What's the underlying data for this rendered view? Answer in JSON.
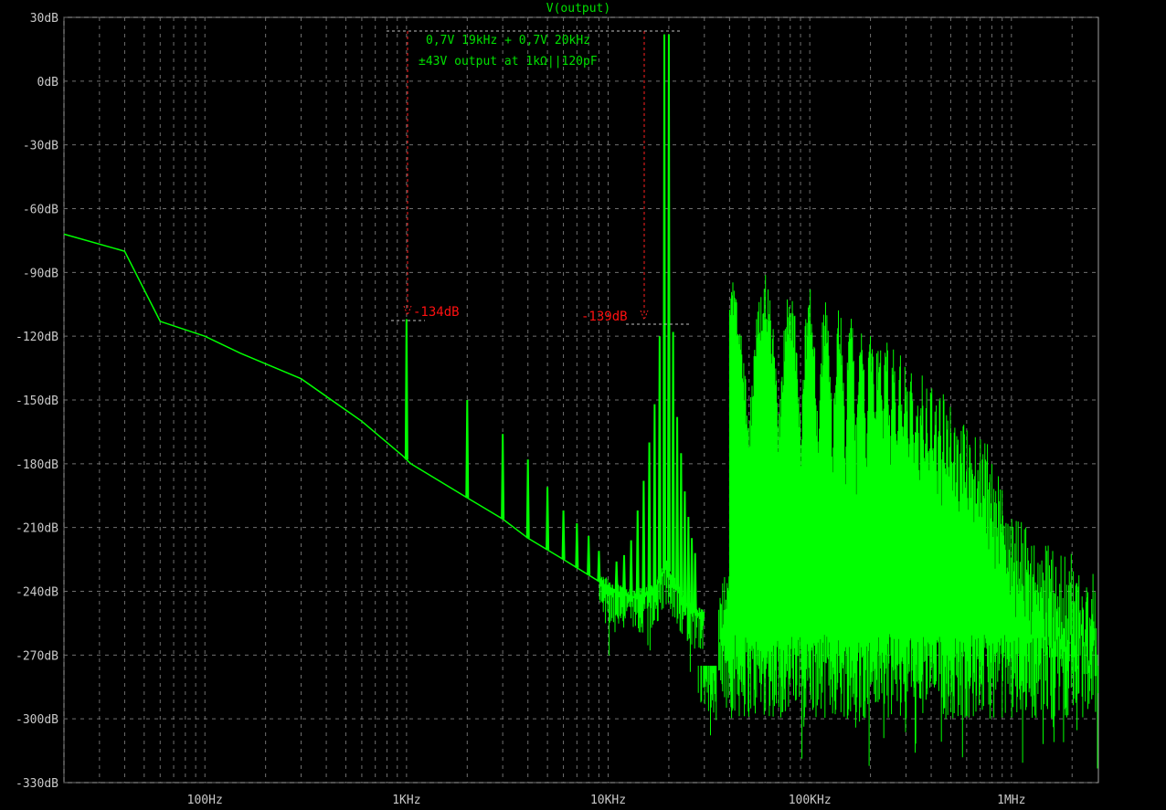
{
  "chart_data": {
    "type": "line",
    "title": "V(output)",
    "xscale": "log",
    "xlim_hz": [
      20,
      2700000
    ],
    "ylim_db": [
      -330,
      30
    ],
    "grid": true,
    "y_ticks": [
      30,
      0,
      -30,
      -60,
      -90,
      -120,
      -150,
      -180,
      -210,
      -240,
      -270,
      -300,
      -330
    ],
    "y_tick_labels": [
      "30dB",
      "0dB",
      "-30dB",
      "-60dB",
      "-90dB",
      "-120dB",
      "-150dB",
      "-180dB",
      "-210dB",
      "-240dB",
      "-270dB",
      "-300dB",
      "-330dB"
    ],
    "x_ticks": [
      100,
      1000,
      10000,
      100000,
      1000000
    ],
    "x_tick_labels": [
      "100Hz",
      "1KHz",
      "10KHz",
      "100KHz",
      "1MHz"
    ],
    "annotations": [
      "0,7V 19kHz + 0,7V 20kHz",
      "±43V output at 1kΩ||120pF"
    ],
    "cursor_labels": [
      "-134dB",
      "-139dB"
    ],
    "trace_color": "#00ff00",
    "cursor_color": "#ff0000",
    "baseline": [
      [
        20,
        -72
      ],
      [
        40,
        -80
      ],
      [
        60,
        -113
      ],
      [
        100,
        -120
      ],
      [
        150,
        -128
      ],
      [
        300,
        -140
      ],
      [
        600,
        -160
      ],
      [
        950,
        -176
      ],
      [
        1050,
        -180
      ],
      [
        2000,
        -196
      ],
      [
        3000,
        -206
      ],
      [
        4000,
        -215
      ],
      [
        6000,
        -225
      ],
      [
        10000,
        -238
      ],
      [
        13000,
        -243
      ],
      [
        17000,
        -240
      ],
      [
        18500,
        -232
      ],
      [
        19500,
        -228
      ],
      [
        21000,
        -236
      ],
      [
        25000,
        -248
      ],
      [
        30000,
        -252
      ]
    ],
    "spikes": [
      [
        1000,
        -112
      ],
      [
        2000,
        -150
      ],
      [
        3000,
        -166
      ],
      [
        4000,
        -178
      ],
      [
        5000,
        -191
      ],
      [
        6000,
        -202
      ],
      [
        7000,
        -208
      ],
      [
        8000,
        -214
      ],
      [
        9000,
        -221
      ],
      [
        11000,
        -226
      ],
      [
        12000,
        -223
      ],
      [
        13000,
        -216
      ],
      [
        14000,
        -202
      ],
      [
        15000,
        -188
      ],
      [
        16000,
        -170
      ],
      [
        17000,
        -152
      ],
      [
        18000,
        -120
      ],
      [
        19000,
        22
      ],
      [
        20000,
        22
      ],
      [
        21000,
        -118
      ],
      [
        22000,
        -158
      ],
      [
        23000,
        -175
      ],
      [
        24000,
        -193
      ],
      [
        25000,
        -205
      ],
      [
        26000,
        -215
      ],
      [
        27000,
        -222
      ]
    ],
    "lobe_peaks": [
      [
        40000,
        -90
      ],
      [
        60000,
        -91
      ],
      [
        80000,
        -98
      ],
      [
        100000,
        -97
      ],
      [
        120000,
        -101
      ],
      [
        140000,
        -104
      ],
      [
        160000,
        -106
      ],
      [
        180000,
        -110
      ],
      [
        200000,
        -115
      ],
      [
        240000,
        -120
      ],
      [
        280000,
        -125
      ],
      [
        320000,
        -132
      ],
      [
        360000,
        -138
      ],
      [
        400000,
        -140
      ],
      [
        500000,
        -148
      ],
      [
        600000,
        -158
      ],
      [
        800000,
        -170
      ],
      [
        1000000,
        -200
      ],
      [
        1500000,
        -215
      ],
      [
        2000000,
        -222
      ],
      [
        2700000,
        -230
      ]
    ],
    "noise_floor_db": [
      -300,
      -265
    ]
  }
}
